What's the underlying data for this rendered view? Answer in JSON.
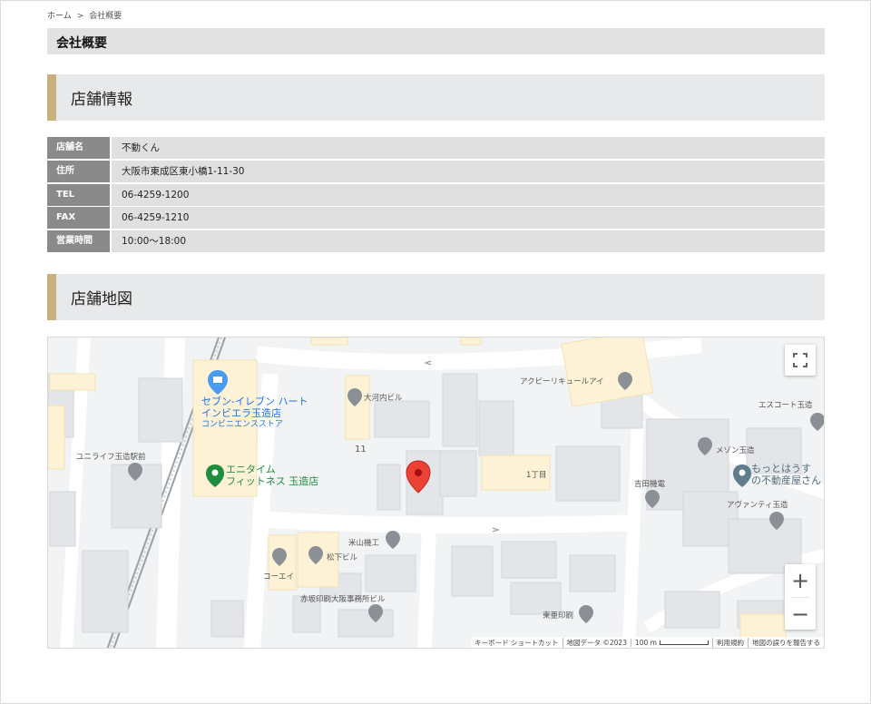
{
  "breadcrumb": {
    "home": "ホーム",
    "separator": ">",
    "current": "会社概要"
  },
  "page_title": "会社概要",
  "store_info": {
    "heading": "店舗情報",
    "rows": [
      {
        "label": "店舗名",
        "value": "不動くん"
      },
      {
        "label": "住所",
        "value": "大阪市東成区東小橋1-11-30"
      },
      {
        "label": "TEL",
        "value": "06-4259-1200"
      },
      {
        "label": "FAX",
        "value": "06-4259-1210"
      },
      {
        "label": "営業時間",
        "value": "10:00〜18:00"
      }
    ]
  },
  "store_map": {
    "heading": "店舗地図",
    "labels": {
      "seven_line1": "セブン-イレブン ハート",
      "seven_line2": "インビエラ玉造店",
      "seven_sub": "コンビニエンスストア",
      "anytime_line1": "エニタイム",
      "anytime_line2": "フィットネス 玉造店",
      "unilife": "ユニライフ玉造駅前",
      "taiga": "大河内ビル",
      "block11": "11",
      "chome1": "1丁目",
      "acubie": "アクビーリキュールアイ",
      "escort": "エスコート玉造",
      "maison": "メゾン玉造",
      "yoshida": "吉田機電",
      "motto_line1": "もっとはうす",
      "motto_line2": "の不動産屋さん",
      "avante": "アヴァンティ玉造",
      "yoneyama": "米山機工",
      "matsushita": "松下ビル",
      "koei": "コーエイ",
      "akasaka": "赤坂印刷大阪事務所ビル",
      "toa": "東亜印刷"
    },
    "controls": {
      "zoom_in": "+",
      "zoom_out": "−"
    },
    "attribution": {
      "keyboard": "キーボード ショートカット",
      "mapdata": "地図データ ©2023",
      "scale": "100 m",
      "terms": "利用規約",
      "report": "地図の誤りを報告する"
    },
    "colors": {
      "green_poi": "#1e8e3e",
      "blue_poi": "#1a73e8",
      "marker": "#ea4335"
    }
  },
  "icons": [
    "fullscreen-icon",
    "location-pin-icon",
    "shop-pin-icon",
    "fitness-pin-icon",
    "grey-poi-pin-icon"
  ]
}
